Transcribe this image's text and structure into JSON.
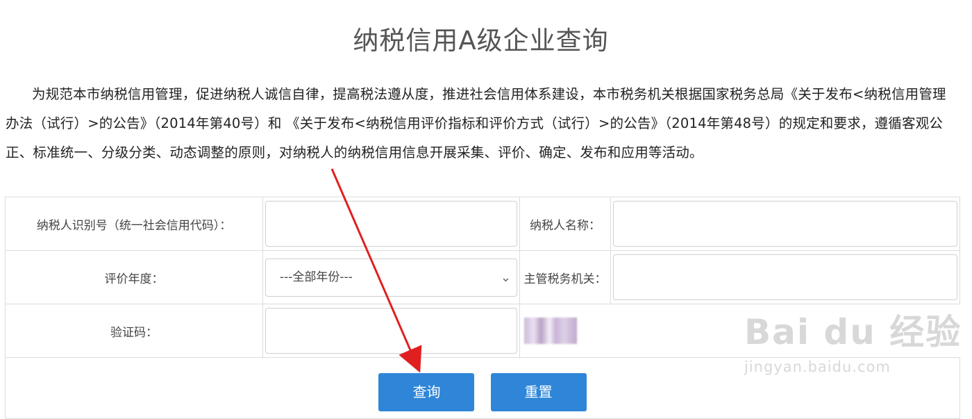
{
  "page": {
    "title": "纳税信用A级企业查询",
    "intro": "为规范本市纳税信用管理，促进纳税人诚信自律，提高税法遵从度，推进社会信用体系建设，本市税务机关根据国家税务总局《关于发布<纳税信用管理办法（试行）>的公告》（2014年第40号）和 《关于发布<纳税信用评价指标和评价方式（试行）>的公告》（2014年第48号）的规定和要求，遵循客观公正、标准统一、分级分类、动态调整的原则，对纳税人的纳税信用信息开展采集、评价、确定、发布和应用等活动。"
  },
  "form": {
    "taxpayer_id_label": "纳税人识别号（统一社会信用代码）：",
    "taxpayer_id_value": "",
    "taxpayer_name_label": "纳税人名称：",
    "taxpayer_name_value": "",
    "year_label": "评价年度：",
    "year_selected": "---全部年份---",
    "authority_label": "主管税务机关：",
    "authority_value": "",
    "captcha_label": "验证码：",
    "captcha_value": ""
  },
  "buttons": {
    "query": "查询",
    "reset": "重置"
  },
  "watermark": {
    "main": "Bai du 经验",
    "sub": "jingyan.baidu.com"
  },
  "colors": {
    "button": "#2f86d8",
    "annotation_arrow": "#e02020"
  }
}
